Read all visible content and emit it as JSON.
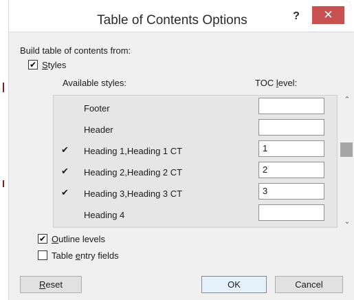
{
  "dialog": {
    "title": "Table of Contents Options",
    "help_label": "?",
    "close_label": "✕"
  },
  "build_from_label": "Build table of contents from:",
  "styles_option": {
    "label_accel": "S",
    "label_rest": "tyles",
    "checked": true,
    "check_glyph": "✔"
  },
  "columns": {
    "available_styles": "Available styles:",
    "toc_level_pre": "TOC ",
    "toc_level_accel": "l",
    "toc_level_post": "evel:"
  },
  "styles": [
    {
      "name": "Footer",
      "level": "",
      "tick": ""
    },
    {
      "name": "Header",
      "level": "",
      "tick": ""
    },
    {
      "name": "Heading 1,Heading 1 CT",
      "level": "1",
      "tick": "✔"
    },
    {
      "name": "Heading 2,Heading 2 CT",
      "level": "2",
      "tick": "✔"
    },
    {
      "name": "Heading 3,Heading 3 CT",
      "level": "3",
      "tick": "✔"
    },
    {
      "name": "Heading 4",
      "level": "",
      "tick": ""
    }
  ],
  "scroll": {
    "up_icon": "⌃",
    "down_icon": "⌄"
  },
  "outline_levels": {
    "label_accel": "O",
    "label_rest": "utline levels",
    "checked": true,
    "check_glyph": "✔"
  },
  "table_entry_fields": {
    "label_pre": "Table ",
    "label_accel": "e",
    "label_post": "ntry fields",
    "checked": false,
    "check_glyph": ""
  },
  "buttons": {
    "reset_accel": "R",
    "reset_rest": "eset",
    "ok": "OK",
    "cancel": "Cancel"
  }
}
